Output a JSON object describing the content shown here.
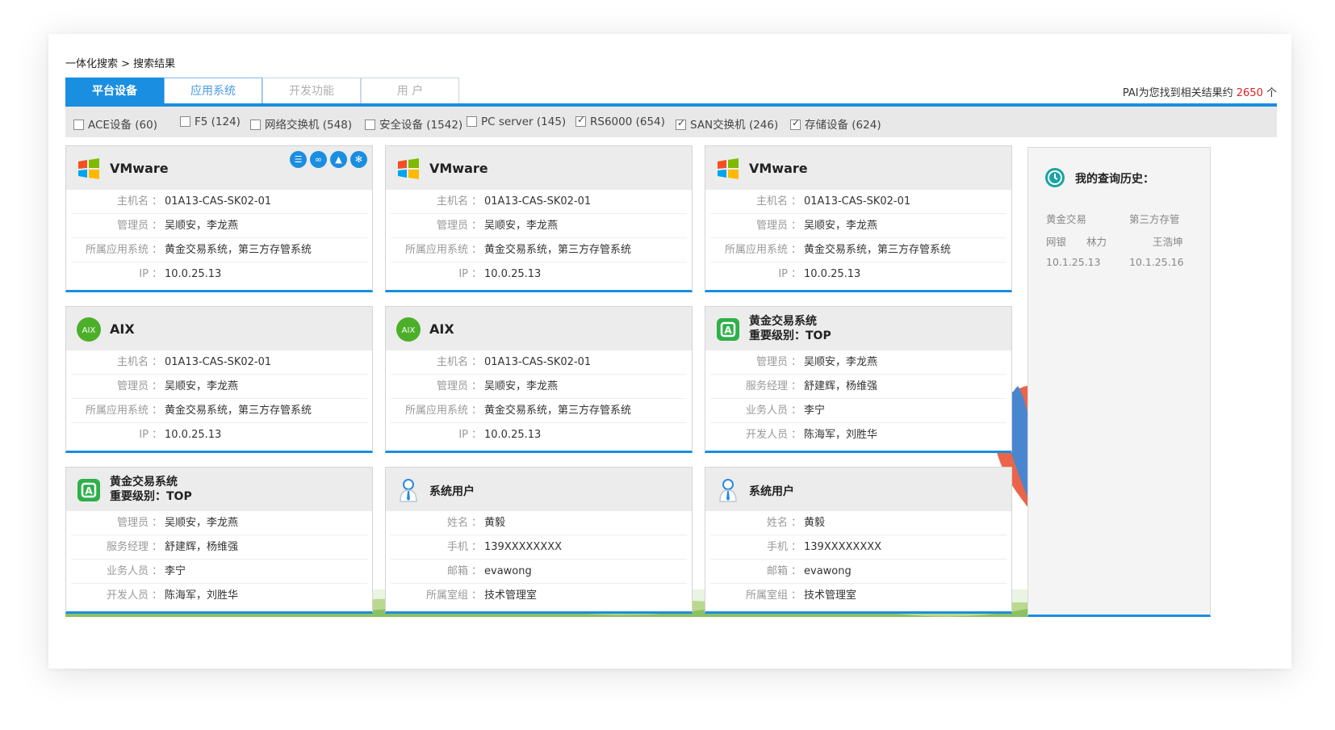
{
  "breadcrumb": "一体化搜索 > 搜索结果",
  "tabs": [
    "平台设备",
    "应用系统",
    "开发功能",
    "用 户"
  ],
  "result_summary": {
    "prefix": "PAI为您找到相关结果约 ",
    "count": "2650",
    "suffix": " 个"
  },
  "filters": [
    {
      "label": "ACE设备 (60)",
      "checked": false
    },
    {
      "label": "F5 (124)",
      "checked": false
    },
    {
      "label": "网络交换机 (548)",
      "checked": false
    },
    {
      "label": "安全设备 (1542)",
      "checked": false
    },
    {
      "label": "PC server (145)",
      "checked": false
    },
    {
      "label": "RS6000 (654)",
      "checked": true
    },
    {
      "label": "SAN交换机 (246)",
      "checked": true
    },
    {
      "label": "存储设备 (624)",
      "checked": true
    }
  ],
  "cards": [
    {
      "kind": "vmware",
      "title": "VMware",
      "icon": "windows-logo-icon",
      "rows": [
        [
          "主机名",
          "01A13-CAS-SK02-01"
        ],
        [
          "管理员",
          "吴顺安，李龙燕"
        ],
        [
          "所属应用系统",
          "黄金交易系统，第三方存管系统"
        ],
        [
          "IP",
          "10.0.25.13"
        ]
      ]
    },
    {
      "kind": "vmware",
      "title": "VMware",
      "icon": "windows-logo-icon",
      "rows": [
        [
          "主机名",
          "01A13-CAS-SK02-01"
        ],
        [
          "管理员",
          "吴顺安，李龙燕"
        ],
        [
          "所属应用系统",
          "黄金交易系统，第三方存管系统"
        ],
        [
          "IP",
          "10.0.25.13"
        ]
      ]
    },
    {
      "kind": "vmware",
      "title": "VMware",
      "icon": "windows-logo-icon",
      "rows": [
        [
          "主机名",
          "01A13-CAS-SK02-01"
        ],
        [
          "管理员",
          "吴顺安，李龙燕"
        ],
        [
          "所属应用系统",
          "黄金交易系统，第三方存管系统"
        ],
        [
          "IP",
          "10.0.25.13"
        ]
      ]
    },
    {
      "kind": "aix",
      "title": "AIX",
      "icon": "aix-logo-icon",
      "badge": "AIX",
      "rows": [
        [
          "主机名",
          "01A13-CAS-SK02-01"
        ],
        [
          "管理员",
          "吴顺安，李龙燕"
        ],
        [
          "所属应用系统",
          "黄金交易系统，第三方存管系统"
        ],
        [
          "IP",
          "10.0.25.13"
        ]
      ]
    },
    {
      "kind": "aix",
      "title": "AIX",
      "icon": "aix-logo-icon",
      "badge": "AIX",
      "rows": [
        [
          "主机名",
          "01A13-CAS-SK02-01"
        ],
        [
          "管理员",
          "吴顺安，李龙燕"
        ],
        [
          "所属应用系统",
          "黄金交易系统，第三方存管系统"
        ],
        [
          "IP",
          "10.0.25.13"
        ]
      ]
    },
    {
      "kind": "app",
      "title": "黄金交易系统",
      "subtitle": "重要级别：TOP",
      "icon": "application-icon",
      "badge": "A",
      "rows": [
        [
          "管理员",
          "吴顺安，李龙燕"
        ],
        [
          "服务经理",
          "舒建辉，杨维强"
        ],
        [
          "业务人员",
          "李宁"
        ],
        [
          "开发人员",
          "陈海军，刘胜华"
        ]
      ]
    },
    {
      "kind": "app",
      "title": "黄金交易系统",
      "subtitle": "重要级别：TOP",
      "icon": "application-icon",
      "badge": "A",
      "rows": [
        [
          "管理员",
          "吴顺安，李龙燕"
        ],
        [
          "服务经理",
          "舒建辉，杨维强"
        ],
        [
          "业务人员",
          "李宁"
        ],
        [
          "开发人员",
          "陈海军，刘胜华"
        ]
      ]
    },
    {
      "kind": "user",
      "title": "系统用户",
      "icon": "user-icon",
      "rows": [
        [
          "姓名",
          "黄毅"
        ],
        [
          "手机",
          "139XXXXXXXX"
        ],
        [
          "邮箱",
          "evawong"
        ],
        [
          "所属室组",
          "技术管理室"
        ]
      ]
    },
    {
      "kind": "user",
      "title": "系统用户",
      "icon": "user-icon",
      "rows": [
        [
          "姓名",
          "黄毅"
        ],
        [
          "手机",
          "139XXXXXXXX"
        ],
        [
          "邮箱",
          "evawong"
        ],
        [
          "所属室组",
          "技术管理室"
        ]
      ]
    }
  ],
  "card_actions": [
    "list-icon",
    "link-icon",
    "bell-icon",
    "settings-icon"
  ],
  "history": {
    "title": "我的查询历史：",
    "items": [
      "黄金交易",
      "第三方存管",
      "网银",
      "林力",
      "王浩坤",
      "10.1.25.13",
      "10.1.25.16"
    ]
  },
  "colors": {
    "accent": "#1a8ee0",
    "count": "#e02020"
  }
}
